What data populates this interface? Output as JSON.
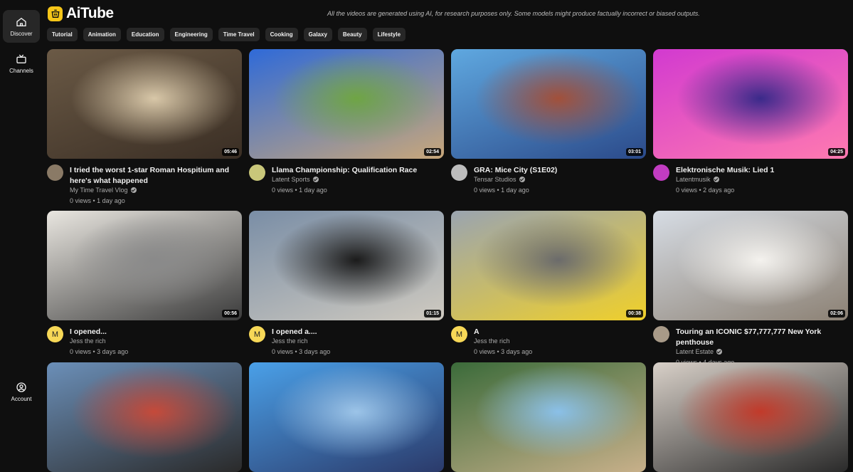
{
  "app": {
    "name": "AiTube",
    "disclaimer": "All the videos are generated using AI, for research purposes only. Some models might produce factually incorrect or biased outputs."
  },
  "sidebar": {
    "items": [
      {
        "label": "Discover",
        "icon": "home-icon",
        "active": true
      },
      {
        "label": "Channels",
        "icon": "tv-icon",
        "active": false
      }
    ],
    "account": {
      "label": "Account",
      "icon": "account-icon"
    }
  },
  "categories": [
    "Tutorial",
    "Animation",
    "Education",
    "Engineering",
    "Time Travel",
    "Cooking",
    "Galaxy",
    "Beauty",
    "Lifestyle"
  ],
  "videos": [
    {
      "title": "I tried the worst 1-star Roman Hospitium and here's what happened",
      "channel": "My Time Travel Vlog",
      "verified": true,
      "views": "0 views",
      "age": "1 day ago",
      "duration": "05:46",
      "avatar_color": "#8a7a66",
      "avatar_letter": ""
    },
    {
      "title": "Llama Championship: Qualification Race",
      "channel": "Latent Sports",
      "verified": true,
      "views": "0 views",
      "age": "1 day ago",
      "duration": "02:54",
      "avatar_color": "#c9c77a",
      "avatar_letter": ""
    },
    {
      "title": "GRA: Mice City (S1E02)",
      "channel": "Tensar Studios",
      "verified": true,
      "views": "0 views",
      "age": "1 day ago",
      "duration": "03:01",
      "avatar_color": "#bdbdbd",
      "avatar_letter": ""
    },
    {
      "title": "Elektronische Musik: Lied 1",
      "channel": "Latentmusik",
      "verified": true,
      "views": "0 views",
      "age": "2 days ago",
      "duration": "04:25",
      "avatar_color": "#c13cc1",
      "avatar_letter": ""
    },
    {
      "title": "I opened...",
      "channel": "Jess the rich",
      "verified": false,
      "views": "0 views",
      "age": "3 days ago",
      "duration": "00:56",
      "avatar_color": "#f7d857",
      "avatar_letter": "M"
    },
    {
      "title": "I opened a....",
      "channel": "Jess the rich",
      "verified": false,
      "views": "0 views",
      "age": "3 days ago",
      "duration": "01:15",
      "avatar_color": "#f7d857",
      "avatar_letter": "M"
    },
    {
      "title": "A",
      "channel": "Jess the rich",
      "verified": false,
      "views": "0 views",
      "age": "3 days ago",
      "duration": "00:38",
      "avatar_color": "#f7d857",
      "avatar_letter": "M"
    },
    {
      "title": "Touring an ICONIC $77,777,777 New York penthouse",
      "channel": "Latent Estate",
      "verified": true,
      "views": "0 views",
      "age": "4 days ago",
      "duration": "02:06",
      "avatar_color": "#a89a88",
      "avatar_letter": ""
    },
    {
      "title": "",
      "channel": "",
      "verified": false,
      "views": "",
      "age": "",
      "duration": "",
      "avatar_color": "",
      "avatar_letter": ""
    },
    {
      "title": "",
      "channel": "",
      "verified": false,
      "views": "",
      "age": "",
      "duration": "",
      "avatar_color": "",
      "avatar_letter": ""
    },
    {
      "title": "",
      "channel": "",
      "verified": false,
      "views": "",
      "age": "",
      "duration": "",
      "avatar_color": "",
      "avatar_letter": ""
    },
    {
      "title": "",
      "channel": "",
      "verified": false,
      "views": "",
      "age": "",
      "duration": "",
      "avatar_color": "",
      "avatar_letter": ""
    }
  ],
  "thumbnail_palettes": [
    [
      "#6b5a46",
      "#d8c7a8",
      "#3a2e24"
    ],
    [
      "#2f6ad8",
      "#6fa544",
      "#c9a77a"
    ],
    [
      "#5fa8e0",
      "#a2503a",
      "#2b4a8a"
    ],
    [
      "#d23ad0",
      "#3a2a8a",
      "#ff7ab0"
    ],
    [
      "#e9e6e0",
      "#8a8a8a",
      "#3b3b3b"
    ],
    [
      "#7a8ea6",
      "#1b1b1b",
      "#cfcac0"
    ],
    [
      "#9aa4b0",
      "#6b6b6b",
      "#f0d02a"
    ],
    [
      "#d6dce4",
      "#f4f2ee",
      "#8c8174"
    ],
    [
      "#6b8fb8",
      "#c54a3a",
      "#2a2a2a"
    ],
    [
      "#4aa0e8",
      "#9cc4e8",
      "#2b3a6a"
    ],
    [
      "#3b6b3a",
      "#8ac0e8",
      "#c8b08a"
    ],
    [
      "#d8d0c8",
      "#c23a2a",
      "#2a2a2a"
    ]
  ]
}
